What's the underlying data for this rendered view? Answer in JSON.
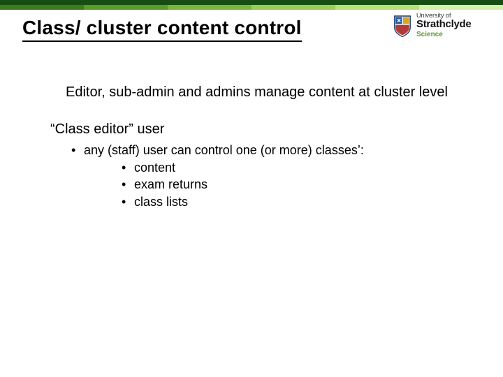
{
  "title": "Class/ cluster content control",
  "logo": {
    "top_line": "University of",
    "name": "Strathclyde",
    "faculty": "Science"
  },
  "body": {
    "para1": "Editor, sub-admin and admins manage content at cluster level",
    "sub_header": "“Class editor” user",
    "bullet_main": "any (staff) user can control one (or more) classes’:",
    "sub_bullets": [
      "content",
      "exam returns",
      "class lists"
    ]
  }
}
